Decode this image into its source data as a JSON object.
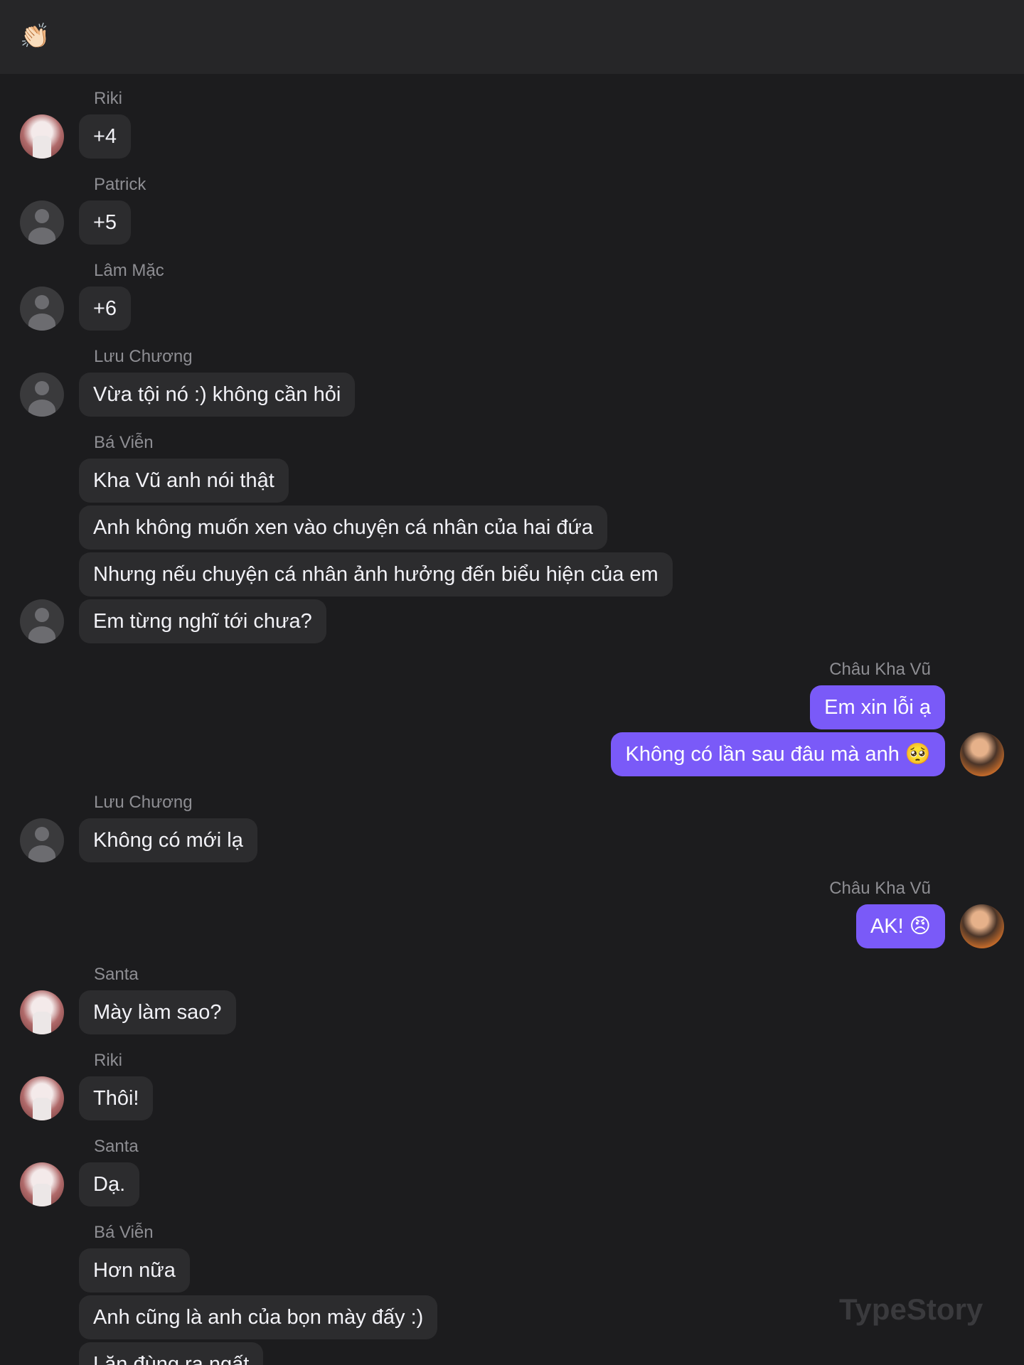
{
  "header": {
    "emoji": "👏🏻"
  },
  "watermark": "TypeStory",
  "messages": [
    {
      "sender": "Riki",
      "text": "+4"
    },
    {
      "sender": "Patrick",
      "text": "+5"
    },
    {
      "sender": "Lâm Mặc",
      "text": "+6"
    },
    {
      "sender": "Lưu Chương",
      "text": "Vừa tội nó :) không cần hỏi"
    },
    {
      "sender": "Bá Viễn",
      "lines": [
        "Kha Vũ anh nói thật",
        "Anh không muốn xen vào chuyện cá nhân của hai đứa",
        "Nhưng nếu chuyện cá nhân ảnh hưởng đến biểu hiện của em",
        "Em từng nghĩ tới chưa?"
      ]
    },
    {
      "sender": "Châu Kha Vũ",
      "lines": [
        "Em xin lỗi ạ",
        "Không có lần sau đâu mà anh 🥺"
      ]
    },
    {
      "sender": "Lưu Chương",
      "text": "Không có mới lạ"
    },
    {
      "sender": "Châu Kha Vũ",
      "text": "AK! 😠"
    },
    {
      "sender": "Santa",
      "text": "Mày làm sao?"
    },
    {
      "sender": "Riki",
      "text": "Thôi!"
    },
    {
      "sender": "Santa",
      "text": "Dạ."
    },
    {
      "sender": "Bá Viễn",
      "lines": [
        "Hơn nữa",
        "Anh cũng là anh của bọn mày đấy :)",
        "Lăn đùng ra ngất"
      ]
    }
  ]
}
